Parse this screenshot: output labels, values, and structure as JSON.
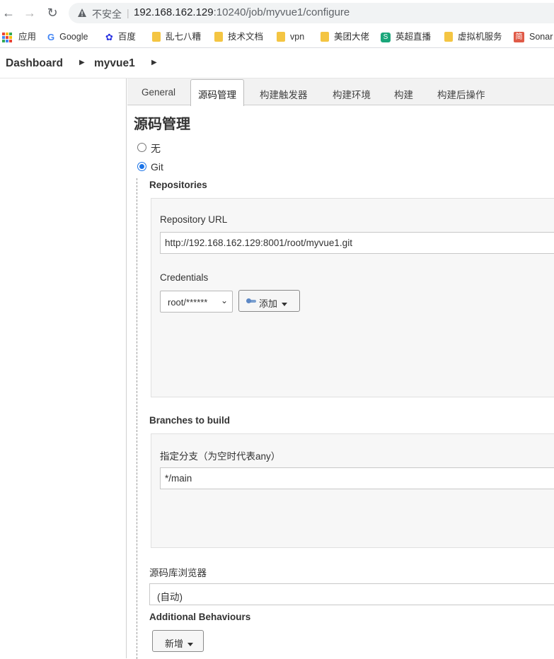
{
  "browser": {
    "insecure_label": "不安全",
    "url_host": "192.168.162.129",
    "url_rest": ":10240/job/myvue1/configure",
    "bookmarks": [
      {
        "label": "应用"
      },
      {
        "label": "Google"
      },
      {
        "label": "百度"
      },
      {
        "label": "乱七八糟"
      },
      {
        "label": "技术文档"
      },
      {
        "label": "vpn"
      },
      {
        "label": "美团大佬"
      },
      {
        "label": "英超直播"
      },
      {
        "label": "虚拟机服务"
      },
      {
        "label": "Sonar"
      }
    ],
    "sonar_icon_char": "简"
  },
  "breadcrumb": {
    "items": [
      "Dashboard",
      "myvue1"
    ]
  },
  "tabs": [
    "General",
    "源码管理",
    "构建触发器",
    "构建环境",
    "构建",
    "构建后操作"
  ],
  "active_tab": "源码管理",
  "scm": {
    "title": "源码管理",
    "option_none": "无",
    "option_git": "Git",
    "selected": "Git",
    "repositories_label": "Repositories",
    "repo_url_label": "Repository URL",
    "repo_url_value": "http://192.168.162.129:8001/root/myvue1.git",
    "credentials_label": "Credentials",
    "credentials_value": "root/******",
    "add_button": "添加",
    "branches_label": "Branches to build",
    "branch_specifier_label": "指定分支（为空时代表any）",
    "branch_value": "*/main",
    "repo_browser_label": "源码库浏览器",
    "repo_browser_value": "(自动)",
    "additional_label": "Additional Behaviours",
    "new_button": "新增"
  },
  "colors": {
    "accent": "#1a73e8",
    "tab_bar": "#f2f2f2",
    "panel_bg": "#f7f7f7"
  }
}
